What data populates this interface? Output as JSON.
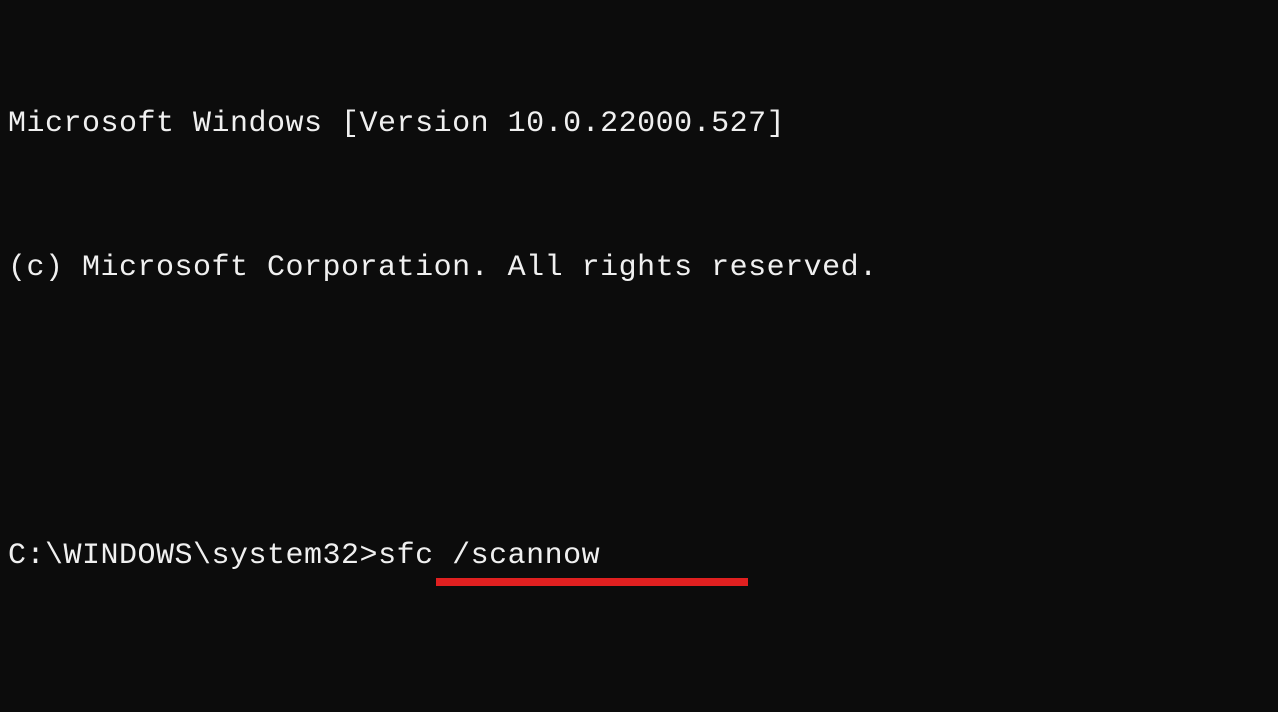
{
  "terminal": {
    "version_line": "Microsoft Windows [Version 10.0.22000.527]",
    "copyright_line": "(c) Microsoft Corporation. All rights reserved.",
    "prompt": "C:\\WINDOWS\\system32>",
    "command": "sfc /scannow"
  },
  "annotation": {
    "underline_color": "#e02020"
  }
}
